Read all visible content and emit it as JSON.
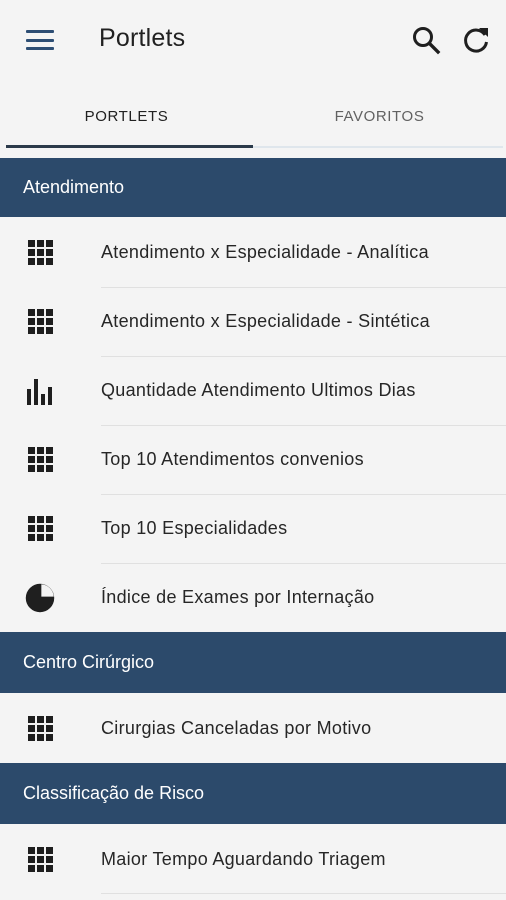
{
  "header": {
    "title": "Portlets"
  },
  "tabs": [
    {
      "label": "PORTLETS",
      "active": true
    },
    {
      "label": "FAVORITOS",
      "active": false
    }
  ],
  "sections": [
    {
      "title": "Atendimento",
      "items": [
        {
          "label": "Atendimento x Especialidade - Analítica",
          "icon": "grid-icon"
        },
        {
          "label": "Atendimento x Especialidade - Sintética",
          "icon": "grid-icon"
        },
        {
          "label": "Quantidade Atendimento Ultimos Dias",
          "icon": "bar-chart-icon"
        },
        {
          "label": "Top 10 Atendimentos convenios",
          "icon": "grid-icon"
        },
        {
          "label": "Top 10 Especialidades",
          "icon": "grid-icon"
        },
        {
          "label": "Índice de Exames por Internação",
          "icon": "pie-chart-icon"
        }
      ]
    },
    {
      "title": "Centro Cirúrgico",
      "items": [
        {
          "label": "Cirurgias Canceladas por Motivo",
          "icon": "grid-icon"
        }
      ]
    },
    {
      "title": "Classificação de Risco",
      "items": [
        {
          "label": "Maior Tempo Aguardando Triagem",
          "icon": "grid-icon"
        }
      ]
    }
  ],
  "colors": {
    "section_bg": "#2c4a6b",
    "accent": "#2d4e74",
    "background": "#f4f4f4"
  }
}
